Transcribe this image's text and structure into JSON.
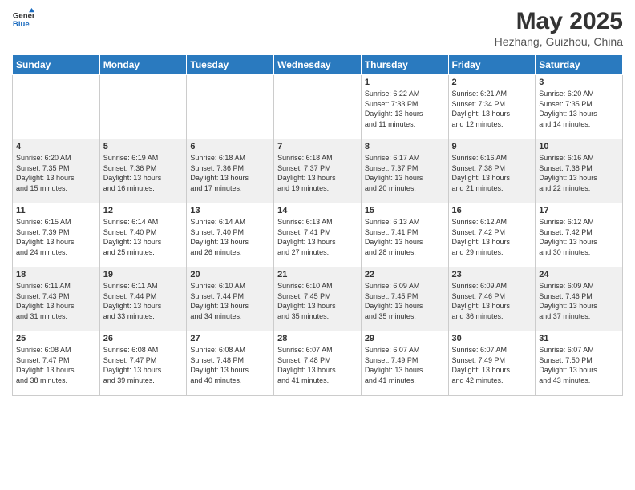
{
  "header": {
    "logo_general": "General",
    "logo_blue": "Blue",
    "month_year": "May 2025",
    "location": "Hezhang, Guizhou, China"
  },
  "weekdays": [
    "Sunday",
    "Monday",
    "Tuesday",
    "Wednesday",
    "Thursday",
    "Friday",
    "Saturday"
  ],
  "weeks": [
    [
      {
        "day": "",
        "info": ""
      },
      {
        "day": "",
        "info": ""
      },
      {
        "day": "",
        "info": ""
      },
      {
        "day": "",
        "info": ""
      },
      {
        "day": "1",
        "info": "Sunrise: 6:22 AM\nSunset: 7:33 PM\nDaylight: 13 hours\nand 11 minutes."
      },
      {
        "day": "2",
        "info": "Sunrise: 6:21 AM\nSunset: 7:34 PM\nDaylight: 13 hours\nand 12 minutes."
      },
      {
        "day": "3",
        "info": "Sunrise: 6:20 AM\nSunset: 7:35 PM\nDaylight: 13 hours\nand 14 minutes."
      }
    ],
    [
      {
        "day": "4",
        "info": "Sunrise: 6:20 AM\nSunset: 7:35 PM\nDaylight: 13 hours\nand 15 minutes."
      },
      {
        "day": "5",
        "info": "Sunrise: 6:19 AM\nSunset: 7:36 PM\nDaylight: 13 hours\nand 16 minutes."
      },
      {
        "day": "6",
        "info": "Sunrise: 6:18 AM\nSunset: 7:36 PM\nDaylight: 13 hours\nand 17 minutes."
      },
      {
        "day": "7",
        "info": "Sunrise: 6:18 AM\nSunset: 7:37 PM\nDaylight: 13 hours\nand 19 minutes."
      },
      {
        "day": "8",
        "info": "Sunrise: 6:17 AM\nSunset: 7:37 PM\nDaylight: 13 hours\nand 20 minutes."
      },
      {
        "day": "9",
        "info": "Sunrise: 6:16 AM\nSunset: 7:38 PM\nDaylight: 13 hours\nand 21 minutes."
      },
      {
        "day": "10",
        "info": "Sunrise: 6:16 AM\nSunset: 7:38 PM\nDaylight: 13 hours\nand 22 minutes."
      }
    ],
    [
      {
        "day": "11",
        "info": "Sunrise: 6:15 AM\nSunset: 7:39 PM\nDaylight: 13 hours\nand 24 minutes."
      },
      {
        "day": "12",
        "info": "Sunrise: 6:14 AM\nSunset: 7:40 PM\nDaylight: 13 hours\nand 25 minutes."
      },
      {
        "day": "13",
        "info": "Sunrise: 6:14 AM\nSunset: 7:40 PM\nDaylight: 13 hours\nand 26 minutes."
      },
      {
        "day": "14",
        "info": "Sunrise: 6:13 AM\nSunset: 7:41 PM\nDaylight: 13 hours\nand 27 minutes."
      },
      {
        "day": "15",
        "info": "Sunrise: 6:13 AM\nSunset: 7:41 PM\nDaylight: 13 hours\nand 28 minutes."
      },
      {
        "day": "16",
        "info": "Sunrise: 6:12 AM\nSunset: 7:42 PM\nDaylight: 13 hours\nand 29 minutes."
      },
      {
        "day": "17",
        "info": "Sunrise: 6:12 AM\nSunset: 7:42 PM\nDaylight: 13 hours\nand 30 minutes."
      }
    ],
    [
      {
        "day": "18",
        "info": "Sunrise: 6:11 AM\nSunset: 7:43 PM\nDaylight: 13 hours\nand 31 minutes."
      },
      {
        "day": "19",
        "info": "Sunrise: 6:11 AM\nSunset: 7:44 PM\nDaylight: 13 hours\nand 33 minutes."
      },
      {
        "day": "20",
        "info": "Sunrise: 6:10 AM\nSunset: 7:44 PM\nDaylight: 13 hours\nand 34 minutes."
      },
      {
        "day": "21",
        "info": "Sunrise: 6:10 AM\nSunset: 7:45 PM\nDaylight: 13 hours\nand 35 minutes."
      },
      {
        "day": "22",
        "info": "Sunrise: 6:09 AM\nSunset: 7:45 PM\nDaylight: 13 hours\nand 35 minutes."
      },
      {
        "day": "23",
        "info": "Sunrise: 6:09 AM\nSunset: 7:46 PM\nDaylight: 13 hours\nand 36 minutes."
      },
      {
        "day": "24",
        "info": "Sunrise: 6:09 AM\nSunset: 7:46 PM\nDaylight: 13 hours\nand 37 minutes."
      }
    ],
    [
      {
        "day": "25",
        "info": "Sunrise: 6:08 AM\nSunset: 7:47 PM\nDaylight: 13 hours\nand 38 minutes."
      },
      {
        "day": "26",
        "info": "Sunrise: 6:08 AM\nSunset: 7:47 PM\nDaylight: 13 hours\nand 39 minutes."
      },
      {
        "day": "27",
        "info": "Sunrise: 6:08 AM\nSunset: 7:48 PM\nDaylight: 13 hours\nand 40 minutes."
      },
      {
        "day": "28",
        "info": "Sunrise: 6:07 AM\nSunset: 7:48 PM\nDaylight: 13 hours\nand 41 minutes."
      },
      {
        "day": "29",
        "info": "Sunrise: 6:07 AM\nSunset: 7:49 PM\nDaylight: 13 hours\nand 41 minutes."
      },
      {
        "day": "30",
        "info": "Sunrise: 6:07 AM\nSunset: 7:49 PM\nDaylight: 13 hours\nand 42 minutes."
      },
      {
        "day": "31",
        "info": "Sunrise: 6:07 AM\nSunset: 7:50 PM\nDaylight: 13 hours\nand 43 minutes."
      }
    ]
  ]
}
